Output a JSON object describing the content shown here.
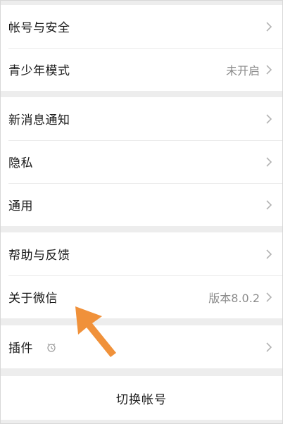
{
  "groups": [
    {
      "items": [
        {
          "label": "帐号与安全",
          "value": ""
        },
        {
          "label": "青少年模式",
          "value": "未开启"
        }
      ]
    },
    {
      "items": [
        {
          "label": "新消息通知",
          "value": ""
        },
        {
          "label": "隐私",
          "value": ""
        },
        {
          "label": "通用",
          "value": ""
        }
      ]
    },
    {
      "items": [
        {
          "label": "帮助与反馈",
          "value": ""
        },
        {
          "label": "关于微信",
          "value": "版本8.0.2"
        }
      ]
    },
    {
      "items": [
        {
          "label": "插件",
          "value": ""
        }
      ]
    }
  ],
  "switch_account_label": "切换帐号",
  "colors": {
    "background": "#ededed",
    "row": "#ffffff",
    "text": "#1a1a1a",
    "secondary_text": "#8c8c8c",
    "annotation_arrow": "#f0913a"
  },
  "icons": [
    "chevron-right-icon",
    "plugin-icon",
    "annotation-arrow"
  ]
}
